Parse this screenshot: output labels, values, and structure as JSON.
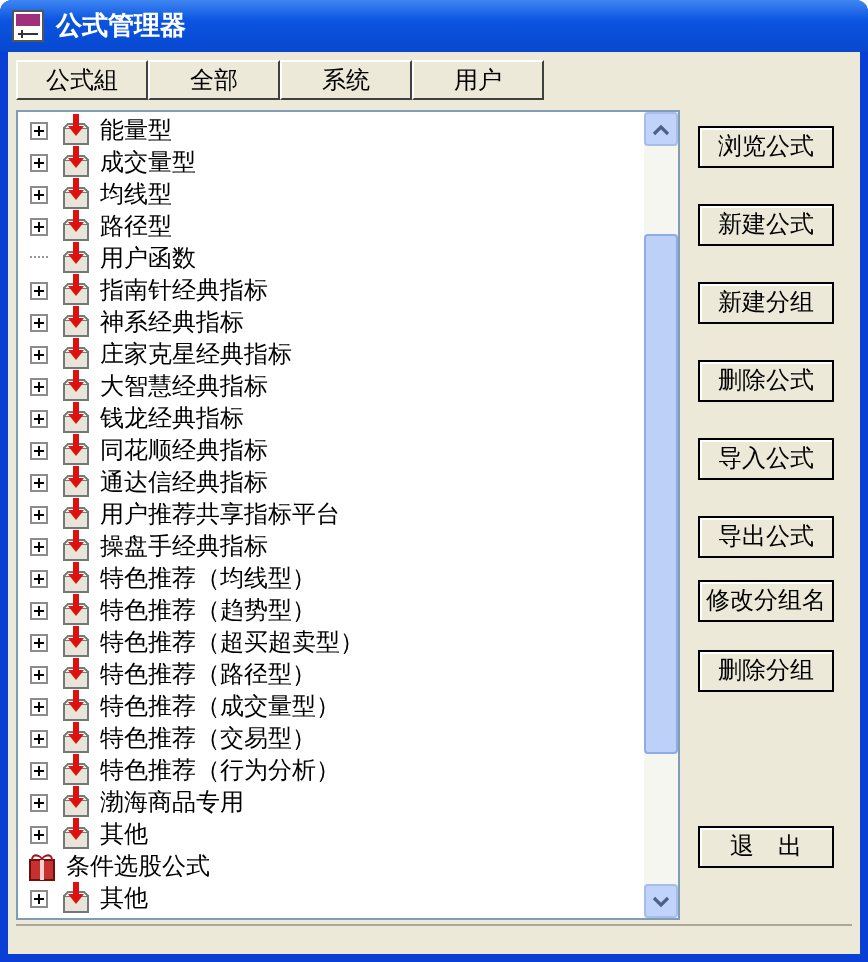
{
  "window": {
    "title": "公式管理器"
  },
  "tabs": [
    {
      "label": "公式組"
    },
    {
      "label": "全部"
    },
    {
      "label": "系统"
    },
    {
      "label": "用户"
    }
  ],
  "tree": [
    {
      "children": [
        {
          "label": "能量型",
          "has_children": true
        },
        {
          "label": "成交量型",
          "has_children": true
        },
        {
          "label": "均线型",
          "has_children": true
        },
        {
          "label": "路径型",
          "has_children": true
        },
        {
          "label": "用户函数",
          "has_children": false
        },
        {
          "label": "指南针经典指标",
          "has_children": true
        },
        {
          "label": "神系经典指标",
          "has_children": true
        },
        {
          "label": "庄家克星经典指标",
          "has_children": true
        },
        {
          "label": "大智慧经典指标",
          "has_children": true
        },
        {
          "label": "钱龙经典指标",
          "has_children": true
        },
        {
          "label": "同花顺经典指标",
          "has_children": true
        },
        {
          "label": "通达信经典指标",
          "has_children": true
        },
        {
          "label": "用户推荐共享指标平台",
          "has_children": true
        },
        {
          "label": "操盘手经典指标",
          "has_children": true
        },
        {
          "label": "特色推荐（均线型）",
          "has_children": true
        },
        {
          "label": "特色推荐（趋势型）",
          "has_children": true
        },
        {
          "label": "特色推荐（超买超卖型）",
          "has_children": true
        },
        {
          "label": "特色推荐（路径型）",
          "has_children": true
        },
        {
          "label": "特色推荐（成交量型）",
          "has_children": true
        },
        {
          "label": "特色推荐（交易型）",
          "has_children": true
        },
        {
          "label": "特色推荐（行为分析）",
          "has_children": true
        },
        {
          "label": "渤海商品专用",
          "has_children": true
        },
        {
          "label": "其他",
          "has_children": true
        }
      ]
    },
    {
      "label": "条件选股公式",
      "kind": "root",
      "children": [
        {
          "label": "其他",
          "has_children": true
        }
      ]
    }
  ],
  "buttons": [
    "浏览公式",
    "新建公式",
    "新建分组",
    "删除公式",
    "导入公式",
    "导出公式",
    "修改分组名",
    "删除分组",
    "退　出"
  ]
}
